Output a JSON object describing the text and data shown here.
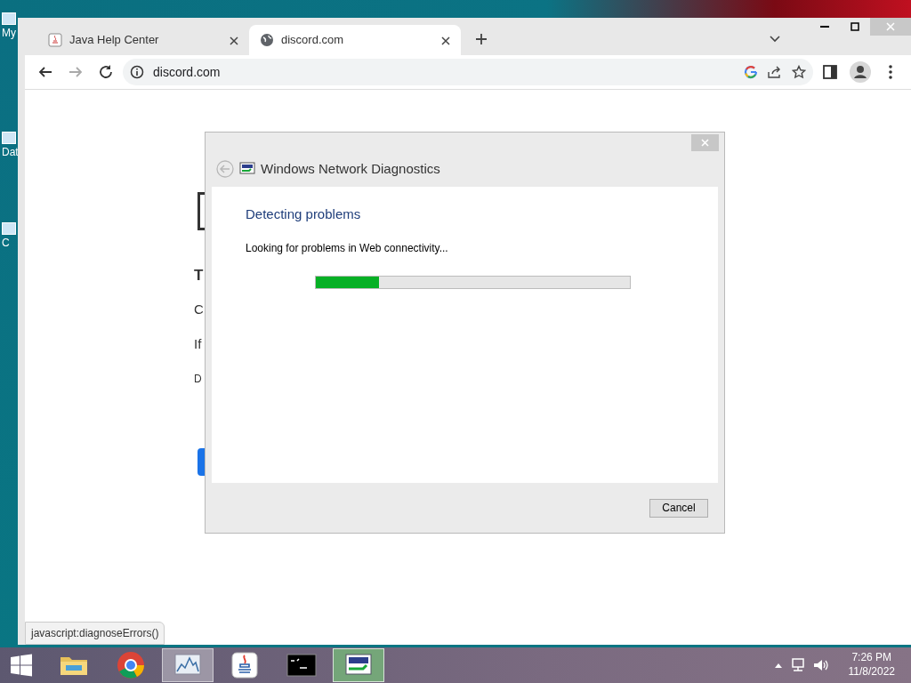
{
  "desktop_icons": [
    {
      "label": "My"
    },
    {
      "label": "Dat"
    },
    {
      "label": "C"
    }
  ],
  "browser": {
    "tabs": [
      {
        "title": "Java Help Center",
        "kind": "java",
        "selected": false
      },
      {
        "title": "discord.com",
        "kind": "globe",
        "selected": true
      }
    ],
    "address": "discord.com",
    "page_fragments": [
      {
        "kind": "heading",
        "text": "T"
      },
      {
        "kind": "text",
        "text": "C"
      },
      {
        "kind": "text",
        "text": "If"
      },
      {
        "kind": "small",
        "text": "D"
      }
    ],
    "status_text": "javascript:diagnoseErrors()"
  },
  "dialog": {
    "title": "Windows Network Diagnostics",
    "heading": "Detecting problems",
    "message": "Looking for problems in Web connectivity...",
    "progress": {
      "level": 0.2
    },
    "buttons": [
      "Cancel"
    ]
  },
  "taskbar": {
    "apps": [
      {
        "kind": "folder",
        "open": false,
        "active": false
      },
      {
        "kind": "chrome",
        "open": false,
        "active": false
      },
      {
        "kind": "monitor",
        "open": true,
        "active": false
      },
      {
        "kind": "java",
        "open": false,
        "active": false
      },
      {
        "kind": "cmd",
        "open": false,
        "active": false
      },
      {
        "kind": "netdiag",
        "open": true,
        "active": true
      }
    ],
    "time": "7:26 PM",
    "date": "11/8/2022"
  }
}
